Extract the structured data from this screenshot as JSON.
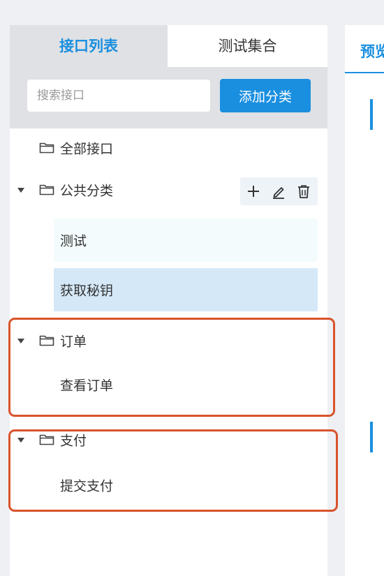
{
  "tabs": {
    "active_label": "接口列表",
    "inactive_label": "测试集合"
  },
  "search": {
    "placeholder": "搜索接口",
    "add_button_label": "添加分类"
  },
  "tree": {
    "all_label": "全部接口",
    "groups": [
      {
        "label": "公共分类",
        "items": [
          "测试",
          "获取秘钥"
        ],
        "actions": [
          "plus-icon",
          "pencil-icon",
          "trash-icon"
        ]
      },
      {
        "label": "订单",
        "items": [
          "查看订单"
        ]
      },
      {
        "label": "支付",
        "items": [
          "提交支付"
        ]
      }
    ]
  },
  "right_panel": {
    "tab_label": "预览"
  },
  "colors": {
    "accent": "#1a8fe0",
    "highlight": "#d9532c",
    "selected_bg": "#d5e8f8"
  }
}
